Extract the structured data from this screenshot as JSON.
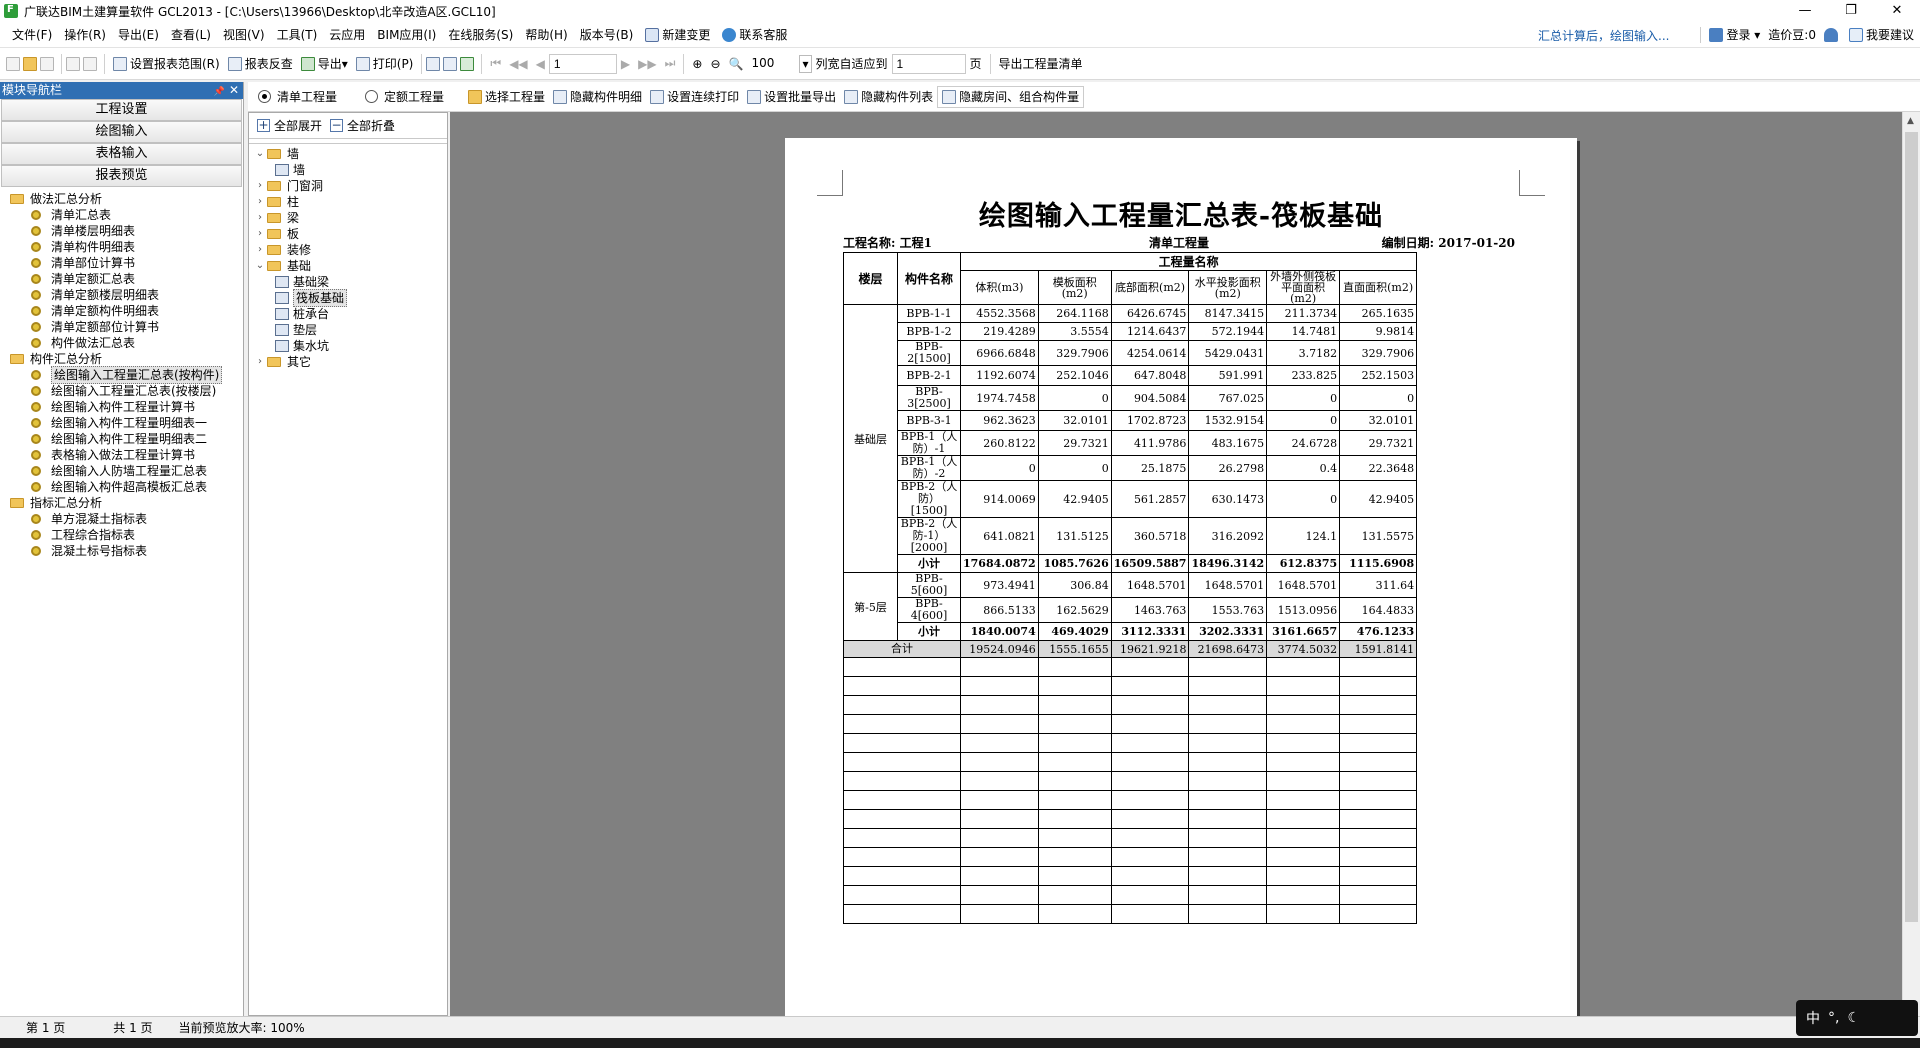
{
  "window": {
    "title": "广联达BIM土建算量软件 GCL2013 - [C:\\Users\\13966\\Desktop\\北辛改造A区.GCL10]",
    "controls": [
      "—",
      "❐",
      "✕"
    ]
  },
  "menu": {
    "items": [
      "文件(F)",
      "操作(R)",
      "导出(E)",
      "查看(L)",
      "视图(V)",
      "工具(T)",
      "云应用",
      "BIM应用(I)",
      "在线服务(S)",
      "帮助(H)",
      "版本号(B)"
    ],
    "new_change": "新建变更",
    "contact": "联系客服",
    "notice": "汇总计算后，绘图输入...",
    "login": "登录",
    "price_beans": "造价豆:0",
    "suggest": "我要建议"
  },
  "toolbar": {
    "set_range": "设置报表范围(R)",
    "report_check": "报表反查",
    "export": "导出",
    "print": "打印(P)",
    "page_input": "1",
    "zoom": "100",
    "fit_mode": "列宽自适应到",
    "fit_value": "1",
    "fit_unit": "页",
    "export_bill": "导出工程量清单"
  },
  "nav": {
    "header": "模块导航栏",
    "pin": "📌",
    "close": "✕",
    "buttons": [
      "工程设置",
      "绘图输入",
      "表格输入",
      "报表预览"
    ],
    "groups": [
      {
        "label": "做法汇总分析",
        "items": [
          "清单汇总表",
          "清单楼层明细表",
          "清单构件明细表",
          "清单部位计算书",
          "清单定额汇总表",
          "清单定额楼层明细表",
          "清单定额构件明细表",
          "清单定额部位计算书",
          "构件做法汇总表"
        ]
      },
      {
        "label": "构件汇总分析",
        "items": [
          "绘图输入工程量汇总表(按构件)",
          "绘图输入工程量汇总表(按楼层)",
          "绘图输入构件工程量计算书",
          "绘图输入构件工程量明细表一",
          "绘图输入构件工程量明细表二",
          "表格输入做法工程量计算书",
          "绘图输入人防墙工程量汇总表",
          "绘图输入构件超高模板汇总表"
        ]
      },
      {
        "label": "指标汇总分析",
        "items": [
          "单方混凝土指标表",
          "工程综合指标表",
          "混凝土标号指标表"
        ]
      }
    ],
    "selected": "绘图输入工程量汇总表(按构件)"
  },
  "options": {
    "radio_bill": "清单工程量",
    "radio_quota": "定额工程量",
    "select_qty": "选择工程量",
    "hide_detail": "隐藏构件明细",
    "continuous_print": "设置连续打印",
    "batch_export": "设置批量导出",
    "hide_list": "隐藏构件列表",
    "hide_room": "隐藏房间、组合构件量"
  },
  "tree": {
    "expand_all": "全部展开",
    "collapse_all": "全部折叠",
    "nodes": [
      {
        "label": "墙",
        "level": 0,
        "caret": "v",
        "icon": "folder"
      },
      {
        "label": "墙",
        "level": 1,
        "caret": "",
        "icon": "leaf"
      },
      {
        "label": "门窗洞",
        "level": 0,
        "caret": ">",
        "icon": "folder"
      },
      {
        "label": "柱",
        "level": 0,
        "caret": ">",
        "icon": "folder"
      },
      {
        "label": "梁",
        "level": 0,
        "caret": ">",
        "icon": "folder"
      },
      {
        "label": "板",
        "level": 0,
        "caret": ">",
        "icon": "folder"
      },
      {
        "label": "装修",
        "level": 0,
        "caret": ">",
        "icon": "folder"
      },
      {
        "label": "基础",
        "level": 0,
        "caret": "v",
        "icon": "folder"
      },
      {
        "label": "基础梁",
        "level": 1,
        "caret": "",
        "icon": "leaf"
      },
      {
        "label": "筏板基础",
        "level": 1,
        "caret": "",
        "icon": "leaf"
      },
      {
        "label": "桩承台",
        "level": 1,
        "caret": "",
        "icon": "leaf"
      },
      {
        "label": "垫层",
        "level": 1,
        "caret": "",
        "icon": "leaf"
      },
      {
        "label": "集水坑",
        "level": 1,
        "caret": "",
        "icon": "leaf"
      },
      {
        "label": "其它",
        "level": 0,
        "caret": ">",
        "icon": "folder"
      }
    ]
  },
  "report": {
    "title": "绘图输入工程量汇总表-筏板基础",
    "project_label": "工程名称: 工程1",
    "qty_type": "清单工程量",
    "date_label": "编制日期: 2017-01-20",
    "header_floor": "楼层",
    "header_name": "构件名称",
    "header_group": "工程量名称",
    "columns": [
      "体积(m3)",
      "模板面积(m2)",
      "底部面积(m2)",
      "水平投影面积(m2)",
      "外墙外侧筏板平面面积(m2)",
      "直面面积(m2)"
    ],
    "floors": [
      {
        "floor": "基础层",
        "rows": [
          {
            "name": "BPB-1-1",
            "values": [
              "4552.3568",
              "264.1168",
              "6426.6745",
              "8147.3415",
              "211.3734",
              "265.1635"
            ]
          },
          {
            "name": "BPB-1-2",
            "values": [
              "219.4289",
              "3.5554",
              "1214.6437",
              "572.1944",
              "14.7481",
              "9.9814"
            ]
          },
          {
            "name": "BPB-2[1500]",
            "values": [
              "6966.6848",
              "329.7906",
              "4254.0614",
              "5429.0431",
              "3.7182",
              "329.7906"
            ]
          },
          {
            "name": "BPB-2-1",
            "values": [
              "1192.6074",
              "252.1046",
              "647.8048",
              "591.991",
              "233.825",
              "252.1503"
            ]
          },
          {
            "name": "BPB-3[2500]",
            "values": [
              "1974.7458",
              "0",
              "904.5084",
              "767.025",
              "0",
              "0"
            ]
          },
          {
            "name": "BPB-3-1",
            "values": [
              "962.3623",
              "32.0101",
              "1702.8723",
              "1532.9154",
              "0",
              "32.0101"
            ]
          },
          {
            "name": "BPB-1（人防）-1",
            "values": [
              "260.8122",
              "29.7321",
              "411.9786",
              "483.1675",
              "24.6728",
              "29.7321"
            ]
          },
          {
            "name": "BPB-1（人防）-2",
            "values": [
              "0",
              "0",
              "25.1875",
              "26.2798",
              "0.4",
              "22.3648"
            ]
          },
          {
            "name": "BPB-2（人防）[1500]",
            "values": [
              "914.0069",
              "42.9405",
              "561.2857",
              "630.1473",
              "0",
              "42.9405"
            ]
          },
          {
            "name": "BPB-2（人防-1）[2000]",
            "values": [
              "641.0821",
              "131.5125",
              "360.5718",
              "316.2092",
              "124.1",
              "131.5575"
            ]
          }
        ],
        "subtotal_label": "小计",
        "subtotal": [
          "17684.0872",
          "1085.7626",
          "16509.5887",
          "18496.3142",
          "612.8375",
          "1115.6908"
        ]
      },
      {
        "floor": "第-5层",
        "rows": [
          {
            "name": "BPB-5[600]",
            "values": [
              "973.4941",
              "306.84",
              "1648.5701",
              "1648.5701",
              "1648.5701",
              "311.64"
            ]
          },
          {
            "name": "BPB-4[600]",
            "values": [
              "866.5133",
              "162.5629",
              "1463.763",
              "1553.763",
              "1513.0956",
              "164.4833"
            ]
          }
        ],
        "subtotal_label": "小计",
        "subtotal": [
          "1840.0074",
          "469.4029",
          "3112.3331",
          "3202.3331",
          "3161.6657",
          "476.1233"
        ]
      }
    ],
    "total_label": "合计",
    "total": [
      "19524.0946",
      "1555.1655",
      "19621.9218",
      "21698.6473",
      "3774.5032",
      "1591.8141"
    ]
  },
  "status": {
    "page": "第 1 页",
    "pages": "共 1 页",
    "zoom": "当前预览放大率: 100%"
  },
  "ime": {
    "mode": "中"
  }
}
